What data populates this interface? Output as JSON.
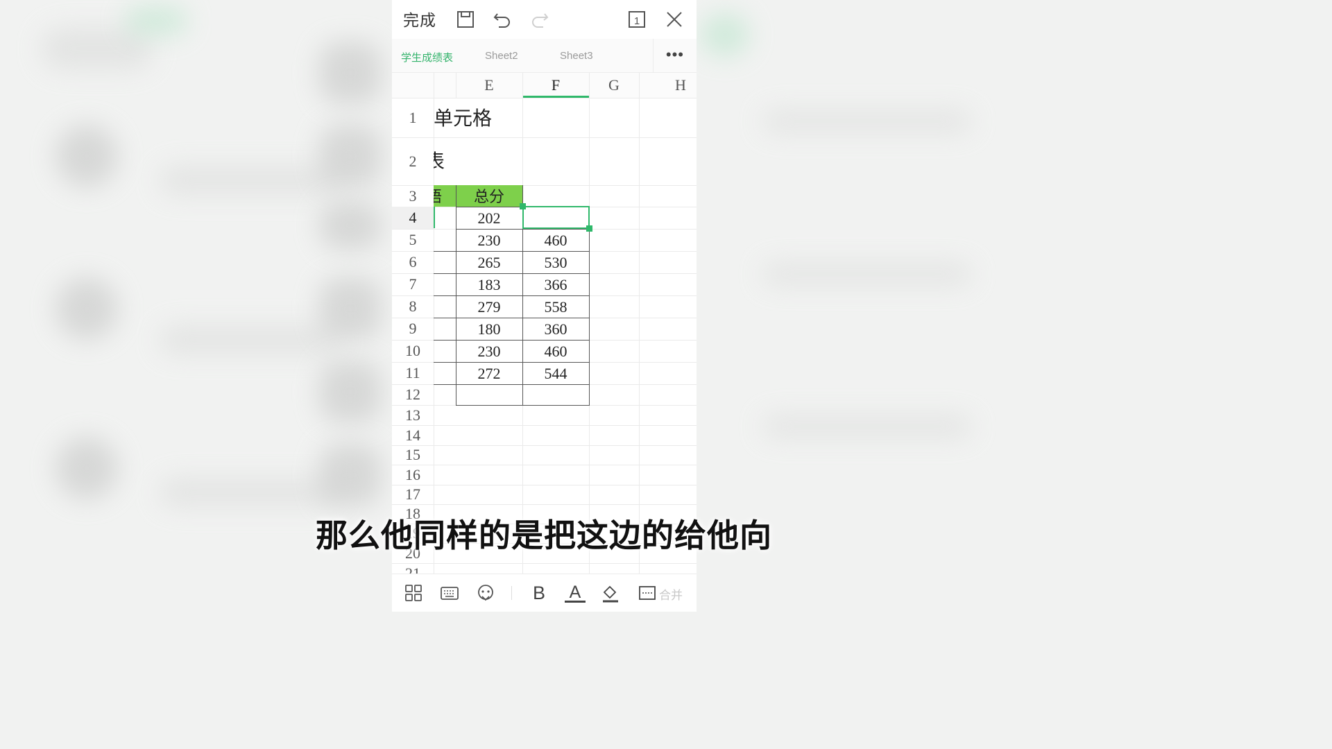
{
  "topbar": {
    "done_label": "完成",
    "icons": [
      "save-icon",
      "undo-icon",
      "redo-icon",
      "page-count-icon",
      "close-icon"
    ],
    "page_count": "1"
  },
  "tabs": [
    {
      "label": "学生成绩表",
      "active": true
    },
    {
      "label": "Sheet2",
      "active": false
    },
    {
      "label": "Sheet3",
      "active": false
    }
  ],
  "more_label": "•••",
  "columns": [
    "E",
    "F",
    "G",
    "H"
  ],
  "selected_column": "F",
  "rows": [
    "1",
    "2",
    "3",
    "4",
    "5",
    "6",
    "7",
    "8",
    "9",
    "10",
    "11",
    "12",
    "13",
    "14",
    "15",
    "16",
    "17",
    "18",
    "19",
    "20",
    "21"
  ],
  "selected_row": "4",
  "sheet": {
    "r1_text": "单元格",
    "r2_text": "表",
    "header_partial": "语",
    "header_total": "总分",
    "header_fill": "#7ed04b",
    "total_values": [
      "202",
      "230",
      "265",
      "183",
      "279",
      "180",
      "230",
      "272"
    ],
    "f_values": [
      "",
      "460",
      "530",
      "366",
      "558",
      "360",
      "460",
      "544"
    ]
  },
  "selection_color": "#2fb86a",
  "bottombar": {
    "icons": [
      "grid-icon",
      "keyboard-icon",
      "voice-icon",
      "bold-icon",
      "font-color-icon",
      "fill-color-icon",
      "merge-icon"
    ],
    "bold_label": "B",
    "font_color_label": "A",
    "merge_label": "合并"
  },
  "subtitle": "那么他同样的是把这边的给他向"
}
